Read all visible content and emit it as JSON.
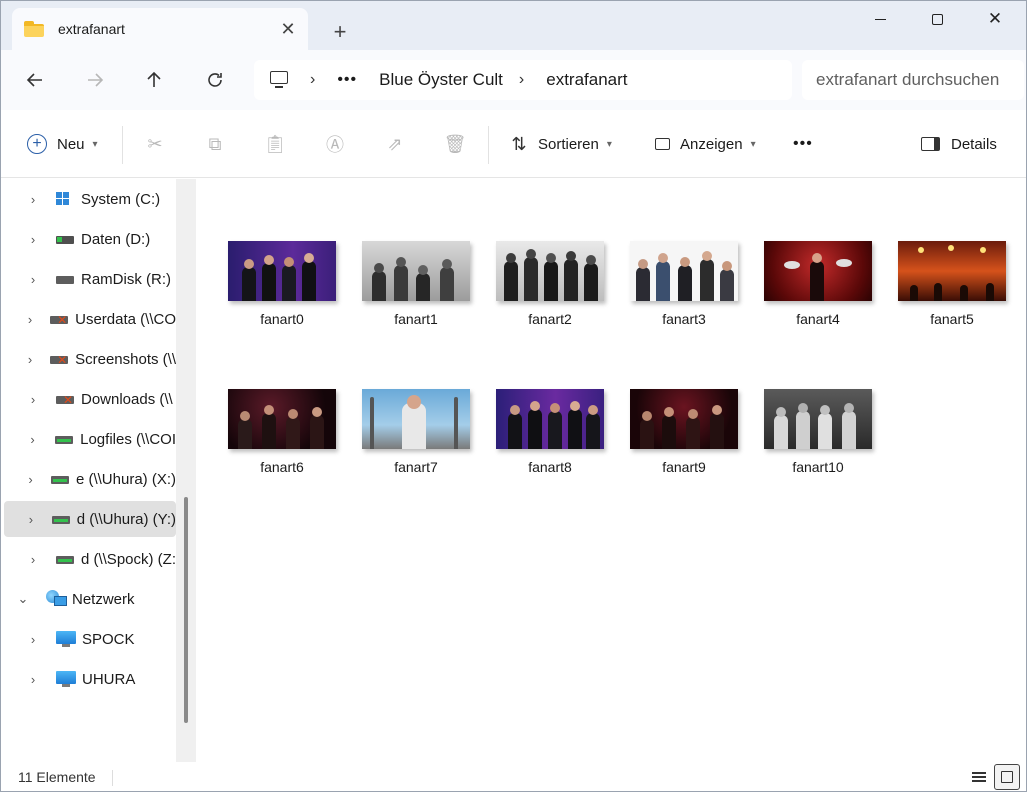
{
  "window": {
    "tab_title": "extrafanart",
    "new_tab": "+"
  },
  "address": {
    "dots": "•••",
    "crumbs": [
      "Blue Öyster Cult",
      "extrafanart"
    ],
    "search_placeholder": "extrafanart durchsuchen"
  },
  "toolbar": {
    "new_label": "Neu",
    "sort_label": "Sortieren",
    "view_label": "Anzeigen",
    "more": "•••",
    "details_label": "Details"
  },
  "sidebar": {
    "items": [
      {
        "label": "System (C:)",
        "icon": "windows-drive-icon"
      },
      {
        "label": "Daten (D:)",
        "icon": "drive-icon"
      },
      {
        "label": "RamDisk (R:)",
        "icon": "drive-icon"
      },
      {
        "label": "Userdata (\\\\CO",
        "icon": "network-drive-disconnected-icon"
      },
      {
        "label": "Screenshots (\\\\",
        "icon": "network-drive-disconnected-icon"
      },
      {
        "label": "Downloads (\\\\",
        "icon": "network-drive-disconnected-icon"
      },
      {
        "label": "Logfiles (\\\\COI",
        "icon": "network-drive-icon"
      },
      {
        "label": "e (\\\\Uhura) (X:)",
        "icon": "network-drive-icon"
      },
      {
        "label": "d (\\\\Uhura) (Y:)",
        "icon": "network-drive-icon",
        "selected": true
      },
      {
        "label": "d (\\\\Spock) (Z:",
        "icon": "network-drive-icon"
      },
      {
        "label": "Netzwerk",
        "icon": "network-icon"
      },
      {
        "label": "SPOCK",
        "icon": "computer-icon"
      },
      {
        "label": "UHURA",
        "icon": "computer-icon"
      }
    ]
  },
  "files": [
    {
      "name": "fanart0"
    },
    {
      "name": "fanart1"
    },
    {
      "name": "fanart2"
    },
    {
      "name": "fanart3"
    },
    {
      "name": "fanart4"
    },
    {
      "name": "fanart5"
    },
    {
      "name": "fanart6"
    },
    {
      "name": "fanart7"
    },
    {
      "name": "fanart8"
    },
    {
      "name": "fanart9"
    },
    {
      "name": "fanart10"
    }
  ],
  "status": {
    "count": "11 Elemente"
  },
  "colors": {
    "titlebar": "#e8edf5",
    "accent": "#2b5fa8",
    "folder": "#fcd35c"
  }
}
